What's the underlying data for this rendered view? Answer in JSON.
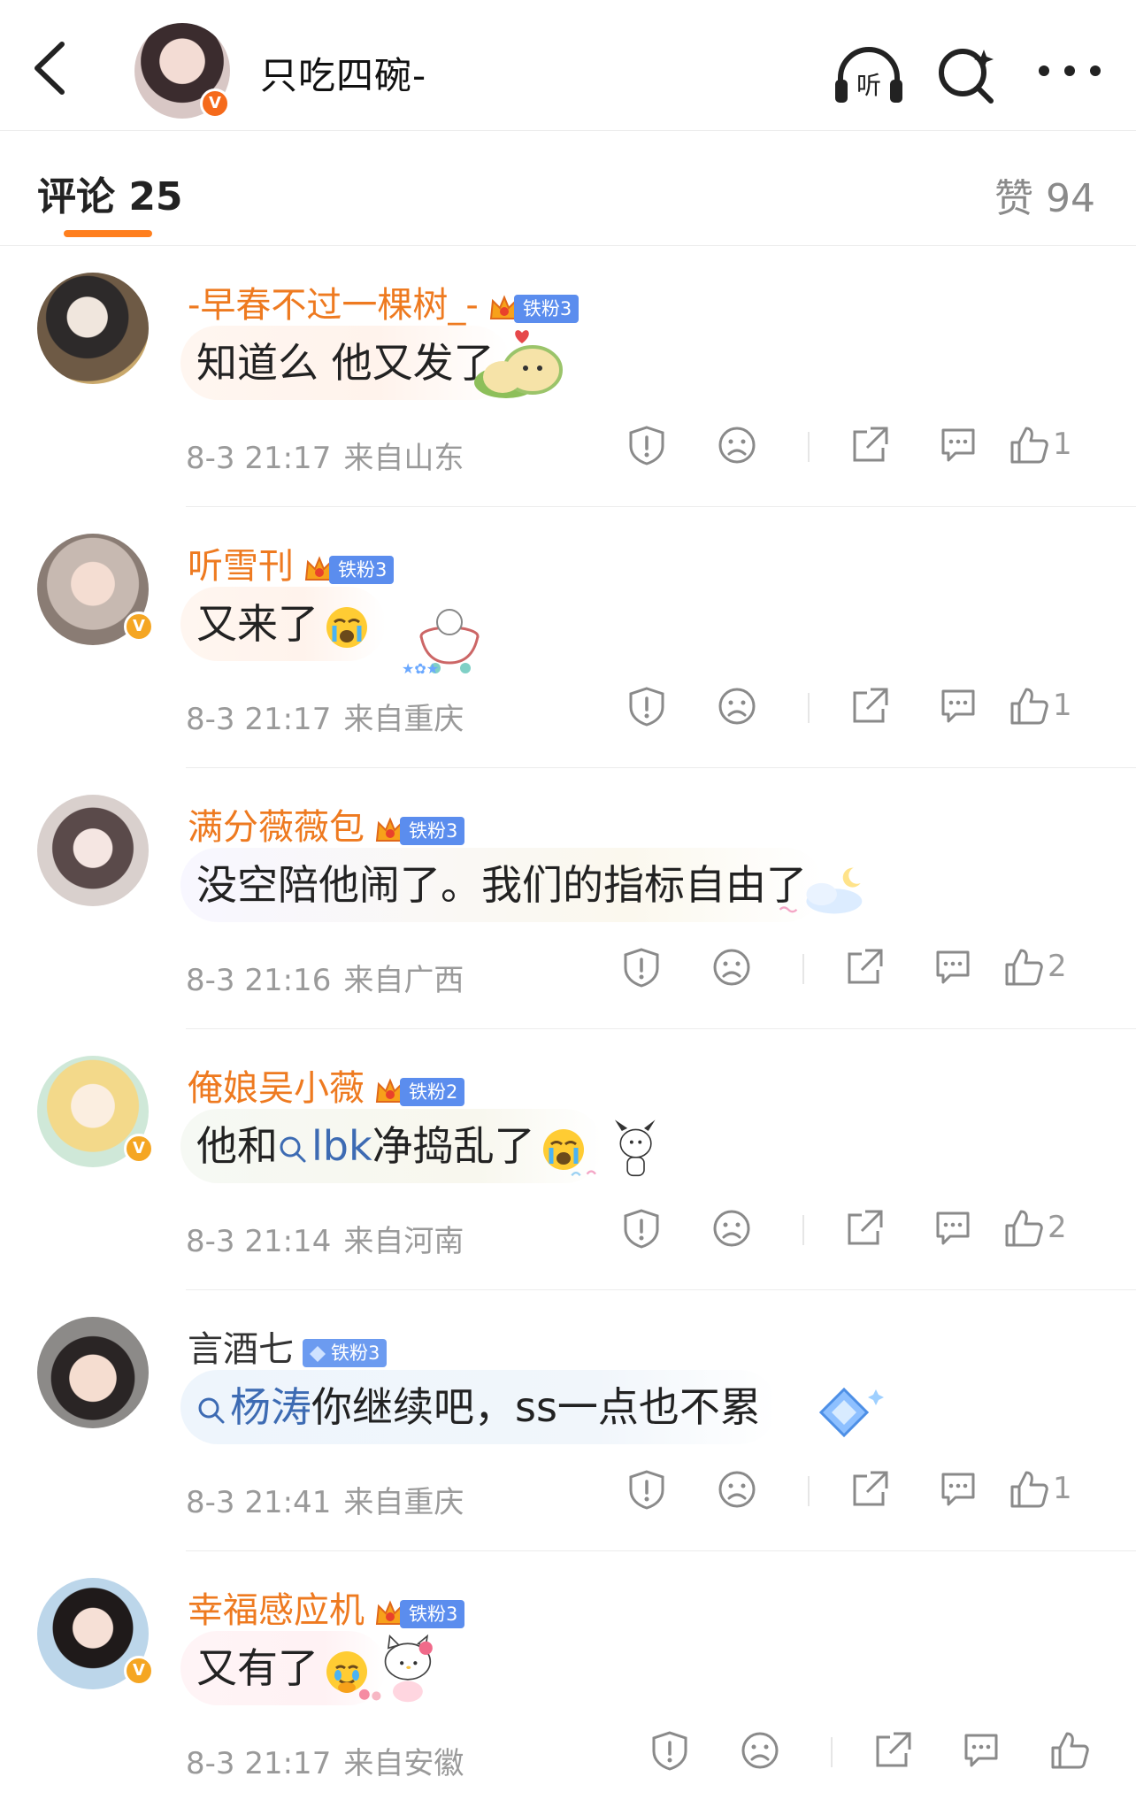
{
  "header": {
    "name": "只吃四碗-",
    "avatar_badge": "V",
    "listen_label": "听"
  },
  "tabs": {
    "comments": "评论 25",
    "likes": "赞 94"
  },
  "colors": {
    "accent": "#ff7f1e",
    "username": "#ee7a20",
    "fan_badge": "#5b8dee",
    "topic_link": "#3d6bb3",
    "meta": "#9a9a9a"
  },
  "comments": [
    {
      "username": "-早春不过一棵树_-",
      "fan_badge": "铁粉3",
      "text": "知道么 他又发了",
      "time": "8-3 21:17",
      "location": "来自山东",
      "likes": "1",
      "verified": false
    },
    {
      "username": "听雪刊",
      "fan_badge": "铁粉3",
      "text": "又来了",
      "time": "8-3 21:17",
      "location": "来自重庆",
      "likes": "1",
      "verified": true,
      "emoji": "crying-face-icon"
    },
    {
      "username": "满分薇薇包",
      "fan_badge": "铁粉3",
      "text": "没空陪他闹了。我们的指标自由了",
      "time": "8-3 21:16",
      "location": "来自广西",
      "likes": "2",
      "verified": false
    },
    {
      "username": "俺娘吴小薇",
      "fan_badge": "铁粉2",
      "text_before": "他和",
      "topic": "lbk",
      "text_after": "净捣乱了",
      "time": "8-3 21:14",
      "location": "来自河南",
      "likes": "2",
      "verified": true,
      "emoji": "crying-face-icon"
    },
    {
      "username": "言酒七",
      "fan_badge": "铁粉3",
      "topic": "杨涛",
      "text_after": "你继续吧，ss一点也不累",
      "time": "8-3 21:41",
      "location": "来自重庆",
      "likes": "1",
      "verified": false
    },
    {
      "username": "幸福感应机",
      "fan_badge": "铁粉3",
      "text": "又有了",
      "time": "8-3 21:17",
      "location": "来自安徽",
      "likes": "",
      "verified": true,
      "emoji": "teary-face-icon"
    }
  ]
}
